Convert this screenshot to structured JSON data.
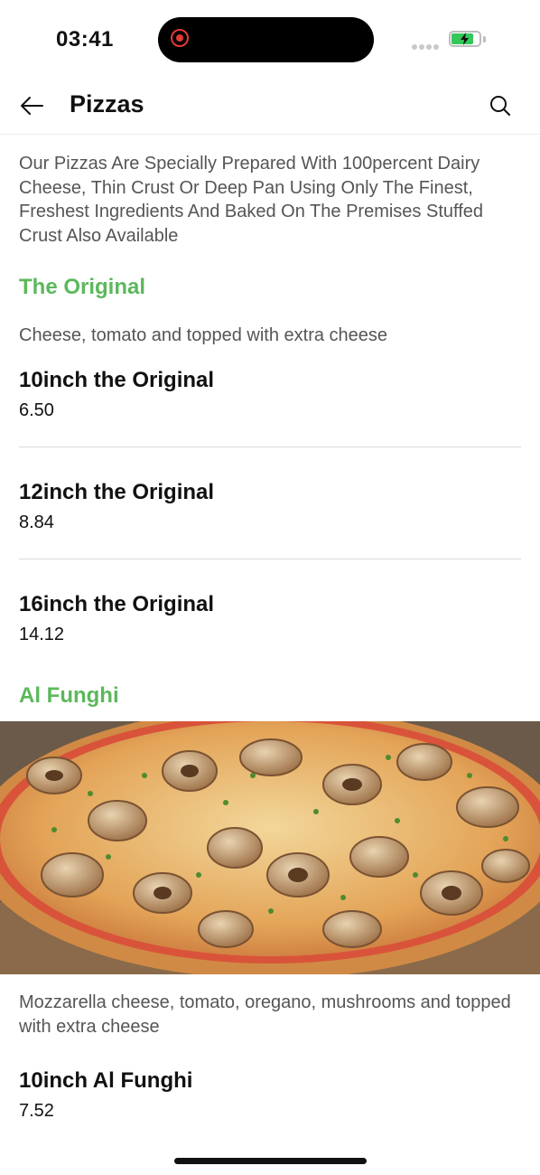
{
  "status": {
    "time": "03:41"
  },
  "header": {
    "title": "Pizzas"
  },
  "intro": "Our Pizzas Are Specially Prepared With 100percent Dairy Cheese, Thin Crust Or Deep Pan Using Only The Finest, Freshest Ingredients And Baked On The Premises Stuffed Crust Also Available",
  "sections": [
    {
      "title": "The Original",
      "description": "Cheese, tomato and topped with extra cheese",
      "items": [
        {
          "name": "10inch the Original",
          "price": "6.50"
        },
        {
          "name": "12inch the Original",
          "price": "8.84"
        },
        {
          "name": "16inch the Original",
          "price": "14.12"
        }
      ]
    },
    {
      "title": "Al Funghi",
      "description": "Mozzarella cheese, tomato, oregano, mushrooms and topped with extra cheese",
      "items": [
        {
          "name": "10inch Al Funghi",
          "price": "7.52"
        }
      ]
    }
  ],
  "colors": {
    "accent": "#5cb85c",
    "battery": "#34c759",
    "recording": "#e53935"
  },
  "icons": {
    "back": "arrow-left-icon",
    "search": "search-icon"
  }
}
